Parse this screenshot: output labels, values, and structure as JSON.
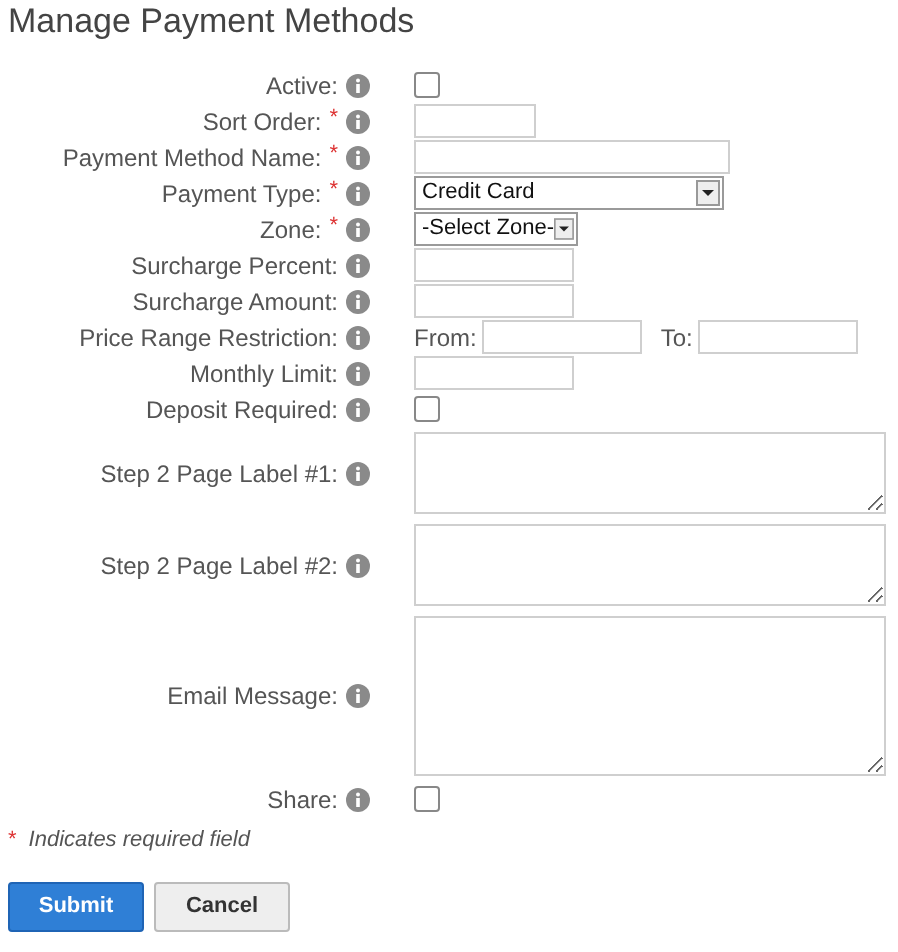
{
  "title": "Manage Payment Methods",
  "required_mark": "*",
  "fields": [
    {
      "label": "Active:",
      "required": false,
      "kind": "checkbox",
      "checked": false
    },
    {
      "label": "Sort Order:",
      "required": true,
      "kind": "short-text"
    },
    {
      "label": "Payment Method Name:",
      "required": true,
      "kind": "long-text"
    },
    {
      "label": "Payment Type:",
      "required": true,
      "kind": "select",
      "value": "Credit Card"
    },
    {
      "label": "Zone:",
      "required": true,
      "kind": "small-select",
      "value": "-Select Zone-"
    },
    {
      "label": "Surcharge Percent:",
      "required": false,
      "kind": "medium-text"
    },
    {
      "label": "Surcharge Amount:",
      "required": false,
      "kind": "medium-text"
    },
    {
      "label": "Price Range Restriction:",
      "required": false,
      "kind": "range",
      "from_label": "From:",
      "to_label": "To:"
    },
    {
      "label": "Monthly Limit:",
      "required": false,
      "kind": "medium-text"
    },
    {
      "label": "Deposit Required:",
      "required": false,
      "kind": "checkbox",
      "checked": false
    },
    {
      "label": "Step 2 Page Label #1:",
      "required": false,
      "kind": "textarea"
    },
    {
      "label": "Step 2 Page Label #2:",
      "required": false,
      "kind": "textarea"
    },
    {
      "label": "Email Message:",
      "required": false,
      "kind": "tall-textarea"
    },
    {
      "label": "Share:",
      "required": false,
      "kind": "checkbox",
      "checked": false
    }
  ],
  "footnote": {
    "mark": "*",
    "text": "Indicates required field"
  },
  "buttons": [
    {
      "label": "Submit",
      "kind": "primary"
    },
    {
      "label": "Cancel",
      "kind": "secondary"
    }
  ]
}
